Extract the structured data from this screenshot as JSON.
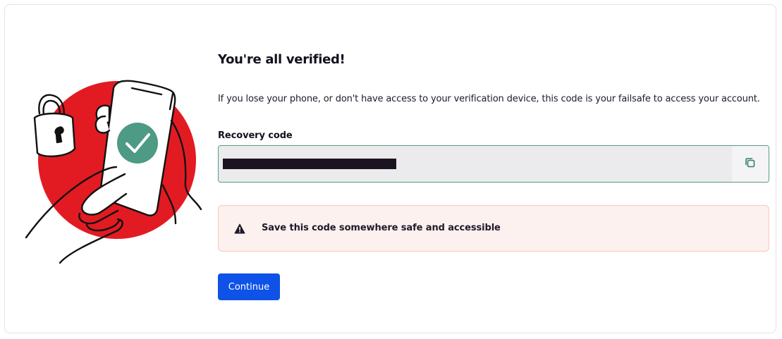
{
  "verification": {
    "title": "You're all verified!",
    "description": "If you lose your phone, or don't have access to your verification device, this code is your failsafe to access your account.",
    "recovery_label": "Recovery code",
    "recovery_code_value": "",
    "copy_icon": "copy-icon",
    "warning_icon": "warning-triangle-icon",
    "warning_text": "Save this code somewhere safe and accessible",
    "continue_label": "Continue"
  },
  "illustration": {
    "icons": [
      "padlock-icon",
      "phone-icon",
      "checkmark-icon",
      "hand-icon"
    ]
  },
  "colors": {
    "accent_red": "#e21b23",
    "check_green": "#4d9a85",
    "primary_button": "#0f52e8",
    "field_border": "#5a9b84",
    "alert_background": "#fcf1ee",
    "alert_border": "#f5c9b7"
  }
}
